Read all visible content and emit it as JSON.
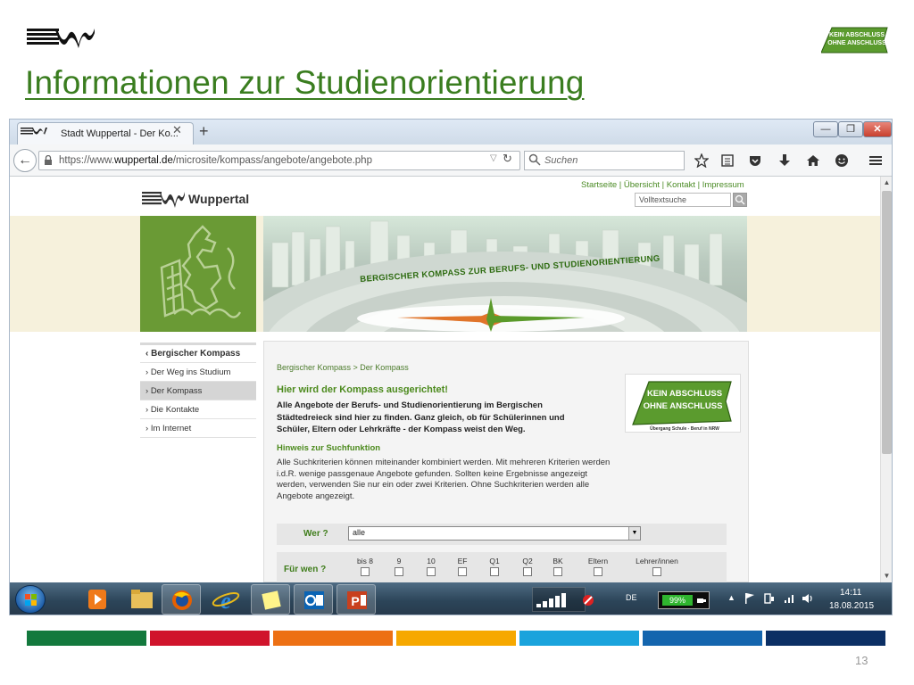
{
  "slide": {
    "title": "Informationen zur Studienorientierung",
    "page_number": "13",
    "badge": {
      "line1": "KEIN ABSCHLUSS",
      "line2": "OHNE ANSCHLUSS",
      "line3": "Übergang Schule - Beruf in NRW"
    },
    "color_bar": [
      "#13793d",
      "#d0142c",
      "#ed7014",
      "#f6a800",
      "#1aa3dc",
      "#1465ae",
      "#0b2f64"
    ]
  },
  "browser": {
    "tab_title": "Stadt Wuppertal - Der Ko...",
    "url_prefix": "https://www.",
    "url_host": "wuppertal.de",
    "url_path": "/microsite/kompass/angebote/angebote.php",
    "search_placeholder": "Suchen"
  },
  "site": {
    "logo_text": "Wuppertal",
    "top_links": "Startseite | Übersicht | Kontakt | Impressum",
    "volltext_placeholder": "Volltextsuche",
    "banner_text": "BERGISCHER KOMPASS ZUR BERUFS- UND STUDIENORIENTIERUNG",
    "nav": {
      "head": "Bergischer Kompass",
      "items": [
        "Der Weg ins Studium",
        "Der Kompass",
        "Die Kontakte",
        "Im Internet"
      ]
    },
    "content": {
      "breadcrumb": "Bergischer Kompass > Der Kompass",
      "heading": "Hier wird der Kompass ausgerichtet!",
      "intro": "Alle Angebote der Berufs- und Studienorientierung im Bergischen Städtedreieck sind hier zu finden. Ganz gleich, ob für Schülerinnen und Schüler, Eltern oder Lehrkräfte - der Kompass weist den Weg.",
      "hint_heading": "Hinweis zur Suchfunktion",
      "hint_text": "Alle Suchkriterien können miteinander kombiniert werden. Mit mehreren Kriterien werden i.d.R. wenige passgenaue Angebote gefunden. Sollten keine Ergebnisse angezeigt werden, verwenden Sie nur ein oder zwei Kriterien. Ohne Suchkriterien werden alle Angebote angezeigt.",
      "wer_label": "Wer ?",
      "wer_value": "alle",
      "fur_label": "Für wen ?",
      "grades": [
        "bis 8",
        "9",
        "10",
        "EF",
        "Q1",
        "Q2",
        "BK",
        "Eltern",
        "Lehrer/innen"
      ]
    }
  },
  "taskbar": {
    "language": "DE",
    "battery": "99%",
    "time": "14:11",
    "date": "18.08.2015"
  }
}
